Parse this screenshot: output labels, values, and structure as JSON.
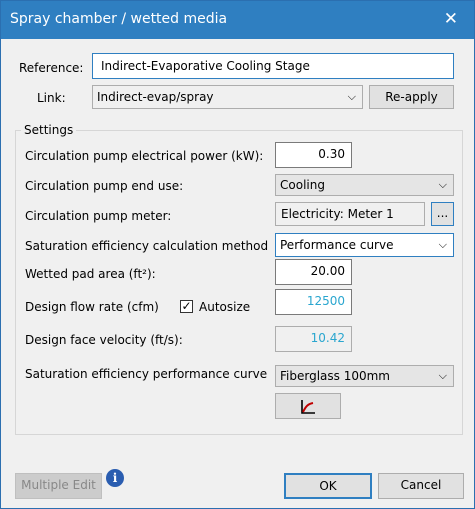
{
  "title": "Spray chamber / wetted media",
  "close_glyph": "✕",
  "reference": {
    "label": "Reference:",
    "value": "Indirect-Evaporative Cooling Stage"
  },
  "link": {
    "label": "Link:",
    "value": "Indirect-evap/spray",
    "reapply": "Re-apply"
  },
  "settings": {
    "title": "Settings",
    "pump_power": {
      "label": "Circulation pump electrical power (kW):",
      "value": "0.30"
    },
    "pump_end_use": {
      "label": "Circulation pump end use:",
      "value": "Cooling"
    },
    "pump_meter": {
      "label": "Circulation pump meter:",
      "value": "Electricity: Meter 1",
      "browse": "..."
    },
    "sat_method": {
      "label": "Saturation efficiency calculation method",
      "value": "Performance curve"
    },
    "pad_area": {
      "label": "Wetted pad area (ft²):",
      "value": "20.00"
    },
    "flow_rate": {
      "label": "Design flow rate (cfm)",
      "value": "12500",
      "autosize_label": "Autosize",
      "autosize_checked": true
    },
    "face_velocity": {
      "label": "Design face velocity (ft/s):",
      "value": "10.42"
    },
    "perf_curve": {
      "label": "Saturation efficiency performance curve",
      "value": "Fiberglass 100mm"
    }
  },
  "footer": {
    "multiple_edit": "Multiple Edit",
    "ok": "OK",
    "cancel": "Cancel",
    "info_glyph": "i"
  },
  "colors": {
    "titlebar": "#2f7fc1",
    "accent_value": "#2aa6cf"
  },
  "icons": {
    "dropdown": "chevron-down-icon",
    "curve": "curve-chart-icon",
    "info": "info-icon"
  }
}
